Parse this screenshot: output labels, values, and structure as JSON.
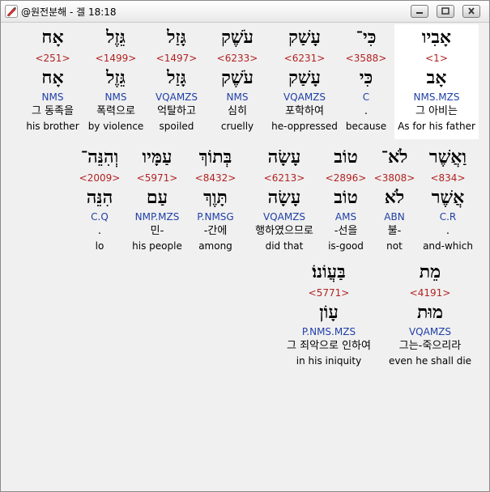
{
  "window": {
    "title": "@원전분해 - 겔 18:18",
    "icon": "app-pen-icon"
  },
  "rows": [
    {
      "words": [
        {
          "surface": "אָבִיו",
          "strong": "<1>",
          "lemma": "אָב",
          "parsing": "NMS.MZS",
          "korean": "그 아비는",
          "english": "As for his father",
          "selected": true
        },
        {
          "surface": "כִּי־",
          "strong": "<3588>",
          "lemma": "כִּי",
          "parsing": "C",
          "korean": ".",
          "english": "because"
        },
        {
          "surface": "עָשַׁק",
          "strong": "<6231>",
          "lemma": "עָשַׁק",
          "parsing": "VQAMZS",
          "korean": "포학하여",
          "english": "he-oppressed"
        },
        {
          "surface": "עֹשֶׁק",
          "strong": "<6233>",
          "lemma": "עֹשֶׁק",
          "parsing": "NMS",
          "korean": "심히",
          "english": "cruelly"
        },
        {
          "surface": "גָּזַל",
          "strong": "<1497>",
          "lemma": "גָּזַל",
          "parsing": "VQAMZS",
          "korean": "억탈하고",
          "english": "spoiled"
        },
        {
          "surface": "גֵּזֶל",
          "strong": "<1499>",
          "lemma": "גֵּזֶל",
          "parsing": "NMS",
          "korean": "폭력으로",
          "english": "by violence"
        },
        {
          "surface": "אָח",
          "strong": "<251>",
          "lemma": "אָח",
          "parsing": "NMS",
          "korean": "그 동족을",
          "english": "his brother"
        }
      ]
    },
    {
      "words": [
        {
          "surface": "וַאֲשֶׁר",
          "strong": "<834>",
          "lemma": "אֲשֶׁר",
          "parsing": "C.R",
          "korean": ".",
          "english": "and-which"
        },
        {
          "surface": "לֹא־",
          "strong": "<3808>",
          "lemma": "לֹא",
          "parsing": "ABN",
          "korean": "불-",
          "english": "not"
        },
        {
          "surface": "טוֹב",
          "strong": "<2896>",
          "lemma": "טוֹב",
          "parsing": "AMS",
          "korean": "-선을",
          "english": "is-good"
        },
        {
          "surface": "עָשָׂה",
          "strong": "<6213>",
          "lemma": "עָשָׂה",
          "parsing": "VQAMZS",
          "korean": "행하였으므로",
          "english": "did that"
        },
        {
          "surface": "בְּתוֹךְ",
          "strong": "<8432>",
          "lemma": "תָּוֶךְ",
          "parsing": "P.NMSG",
          "korean": "-간에",
          "english": "among"
        },
        {
          "surface": "עַמָּיו",
          "strong": "<5971>",
          "lemma": "עַם",
          "parsing": "NMP.MZS",
          "korean": "민-",
          "english": "his people"
        },
        {
          "surface": "וְהִנֵּה־",
          "strong": "<2009>",
          "lemma": "הִנֵּה",
          "parsing": "C.Q",
          "korean": ".",
          "english": "lo"
        }
      ]
    },
    {
      "words": [
        {
          "surface": "מֵת",
          "strong": "<4191>",
          "lemma": "מוּת",
          "parsing": "VQAMZS",
          "korean": "그는-죽으리라",
          "english": "even he shall die"
        },
        {
          "surface": "בַּעֲוֹנוֹ׃",
          "strong": "<5771>",
          "lemma": "עָוֹן",
          "parsing": "P.NMS.MZS",
          "korean": "그 죄악으로 인하여",
          "english": "in his iniquity"
        }
      ]
    }
  ]
}
